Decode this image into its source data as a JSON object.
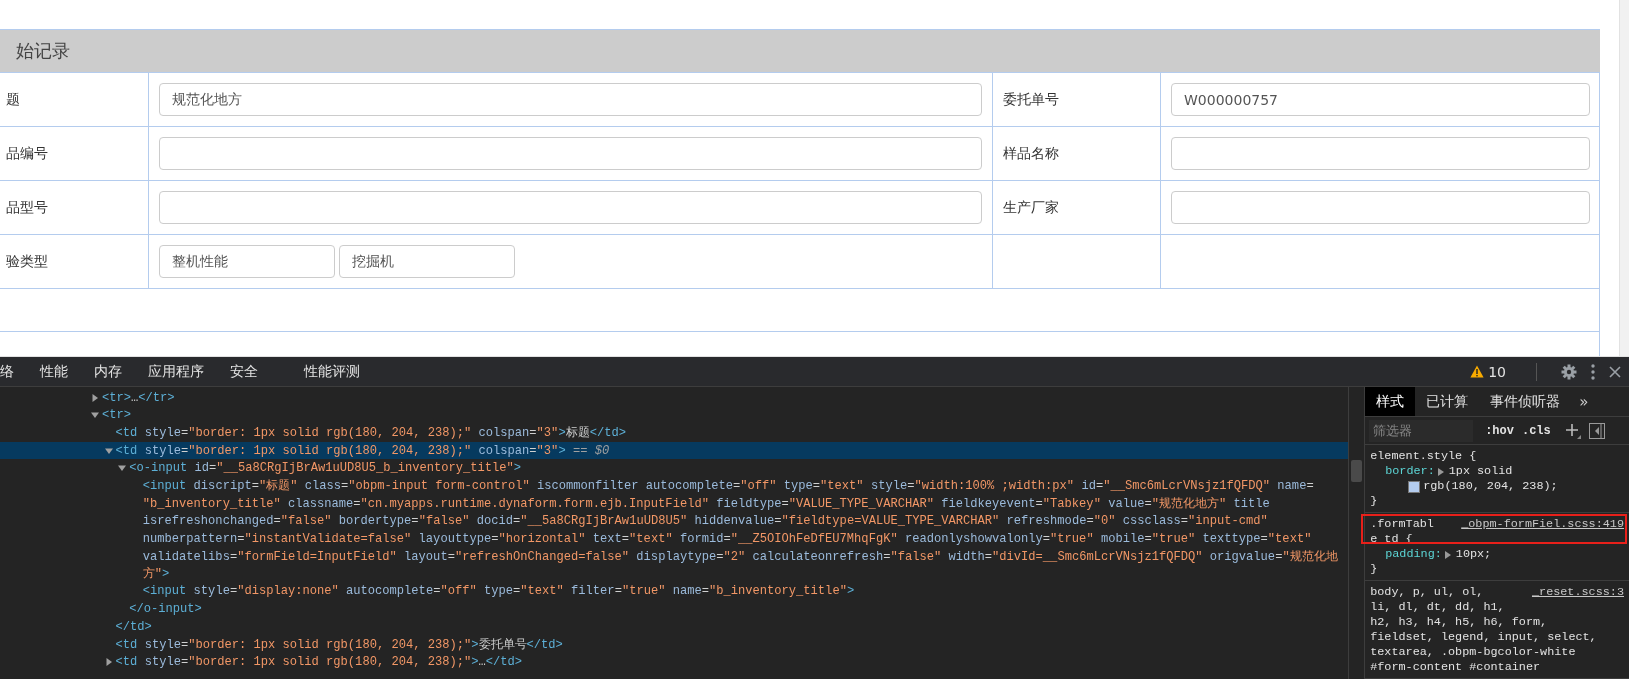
{
  "form": {
    "title": "始记录",
    "rows": [
      {
        "cells": [
          {
            "kind": "label",
            "text": "题"
          },
          {
            "kind": "input",
            "value": "规范化地方"
          },
          {
            "kind": "label",
            "text": "委托单号"
          },
          {
            "kind": "input",
            "value": "W000000757"
          }
        ]
      },
      {
        "cells": [
          {
            "kind": "label",
            "text": "品编号"
          },
          {
            "kind": "input"
          },
          {
            "kind": "label",
            "text": "样品名称"
          },
          {
            "kind": "input"
          }
        ]
      },
      {
        "cells": [
          {
            "kind": "label",
            "text": "品型号"
          },
          {
            "kind": "input"
          },
          {
            "kind": "label",
            "text": "生产厂家"
          },
          {
            "kind": "input"
          }
        ]
      },
      {
        "cells": [
          {
            "kind": "label",
            "text": "验类型"
          },
          {
            "kind": "inputs",
            "values": [
              "整机性能",
              "挖掘机"
            ]
          },
          {
            "kind": "empty"
          },
          {
            "kind": "empty"
          }
        ]
      }
    ]
  },
  "devtools": {
    "tabs": [
      {
        "label": "络",
        "selected": false
      },
      {
        "label": "性能",
        "selected": false
      },
      {
        "label": "内存",
        "selected": false
      },
      {
        "label": "应用程序",
        "selected": false
      },
      {
        "label": "安全",
        "selected": false
      },
      {
        "label": "性能评测",
        "selected": false
      }
    ],
    "warnings": "10",
    "elements": [
      {
        "lines": [
          "<tr>…</tr>"
        ],
        "expanded": false,
        "selected": false
      },
      {
        "lines": [
          "<tr>"
        ],
        "expanded": true,
        "selected": false,
        "children": [
          {
            "lines": [
              "<td style=\"border: 1px solid rgb(180, 204, 238);\" colspan=\"3\">标题</td>"
            ],
            "selected": false
          },
          {
            "lines": [
              "<td style=\"border: 1px solid rgb(180, 204, 238);\" colspan=\"3\">"
            ],
            "suffix": "== $0",
            "expanded": true,
            "selected": true,
            "closing": "</td>",
            "children": [
              {
                "lines": [
                  "<o-input id=\"__5a8CRgIjBrAw1uUD8U5_b_inventory_title\">"
                ],
                "expanded": true,
                "selected": false,
                "closing": "</o-input>",
                "children": [
                  {
                    "lines": [
                      "<input discript=\"标题\" class=\"obpm-input form-control\" iscommonfilter autocomplete=\"off\" type=\"text\" style=\"width:100% ;width:px\" id=\"__Smc6mLcrVNsjz1fQFDQ\" name=",
                      "\"b_inventory_title\" classname=\"cn.myapps.runtime.dynaform.form.ejb.InputField\" fieldtype=\"VALUE_TYPE_VARCHAR\" fieldkeyevent=\"Tabkey\" value=\"规范化地方\" title",
                      "isrefreshonchanged=\"false\" bordertype=\"false\" docid=\"__5a8CRgIjBrAw1uUD8U5\" hiddenvalue=\"fieldtype=VALUE_TYPE_VARCHAR\" refreshmode=\"0\" cssclass=\"input-cmd\"",
                      "numberpattern=\"instantValidate=false\" layouttype=\"horizontal\" text=\"text\" formid=\"__Z5OIOhFeDfEU7MhqFgK\" readonlyshowvalonly=\"true\" mobile=\"true\" texttype=\"text\"",
                      "validatelibs=\"formField=InputField\" layout=\"refreshOnChanged=false\" displaytype=\"2\" calculateonrefresh=\"false\" width=\"divId=__Smc6mLcrVNsjz1fQFDQ\" origvalue=\"规范化地",
                      "方\">"
                    ],
                    "selected": false
                  },
                  {
                    "lines": [
                      "<input style=\"display:none\" autocomplete=\"off\" type=\"text\" filter=\"true\" name=\"b_inventory_title\">"
                    ],
                    "selected": false
                  }
                ]
              }
            ]
          },
          {
            "lines": [
              "<td style=\"border: 1px solid rgb(180, 204, 238);\">委托单号</td>"
            ],
            "selected": false
          },
          {
            "lines": [
              "<td style=\"border: 1px solid rgb(180, 204, 238);\">…</td>"
            ],
            "expanded": false,
            "selected": false
          }
        ]
      }
    ],
    "styles": {
      "tabs": [
        {
          "label": "样式",
          "selected": true
        },
        {
          "label": "已计算",
          "selected": false
        },
        {
          "label": "事件侦听器",
          "selected": false
        }
      ],
      "more": "»",
      "filter": {
        "placeholder": "筛选器"
      },
      "hov": ":hov",
      "cls": ".cls",
      "rules": [
        {
          "selector_lines": [
            "element.style {"
          ],
          "highlighted": false,
          "declarations": [
            {
              "property": "border:",
              "expandable": true,
              "value": "1px solid",
              "swatch_text": "rgb(180, 204, 238);"
            }
          ],
          "close": "}"
        },
        {
          "selector_lines": [
            ".formTabl",
            "e td {"
          ],
          "source": "_obpm-formFiel.scss:419",
          "highlighted": true,
          "declarations": [
            {
              "property": "padding:",
              "expandable": true,
              "value": "10px;"
            }
          ],
          "close": "}"
        },
        {
          "selector_lines": [
            "body, p, ul, ol,",
            "li, dl, dt, dd, h1,",
            "h2, h3, h4, h5, h6, form,",
            "fieldset, legend, input, select,",
            "textarea, .obpm-bgcolor-white",
            "#form-content #container"
          ],
          "source": "_reset.scss:3",
          "highlighted": false
        }
      ]
    }
  }
}
